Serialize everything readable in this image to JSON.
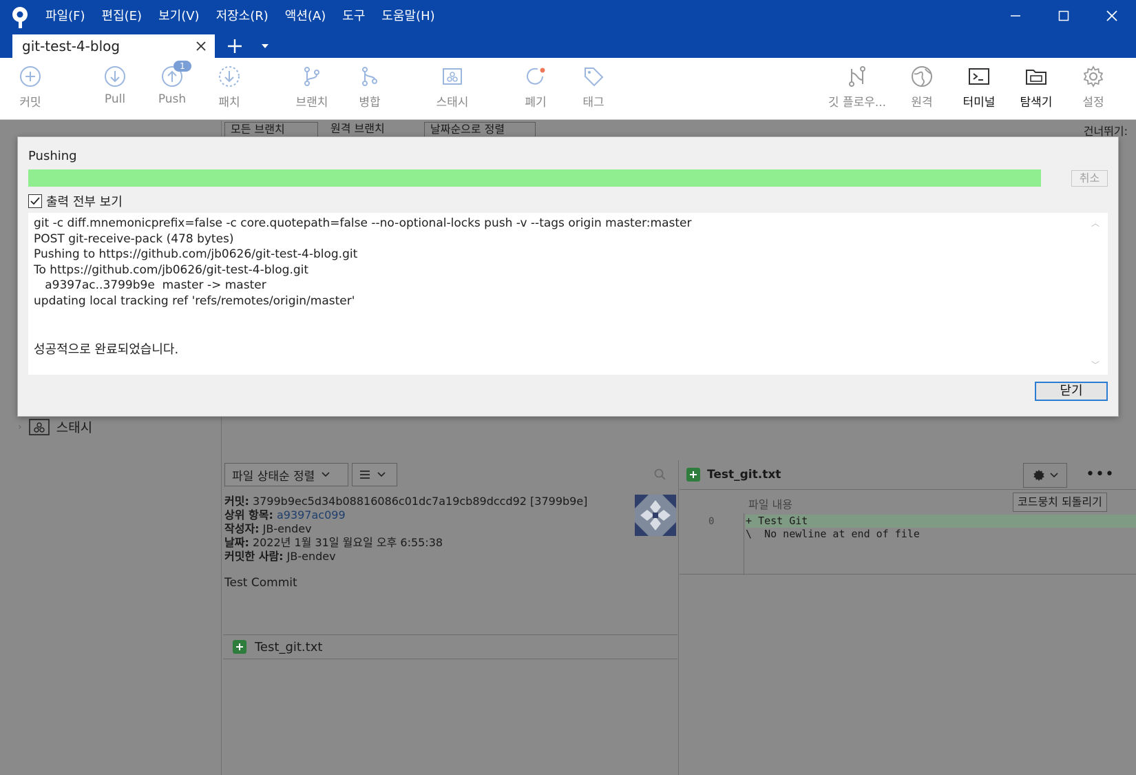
{
  "menu": [
    "파일(F)",
    "편집(E)",
    "보기(V)",
    "저장소(R)",
    "액션(A)",
    "도구",
    "도움말(H)"
  ],
  "tab": {
    "title": "git-test-4-blog"
  },
  "toolbar": {
    "commit": "커밋",
    "pull": "Pull",
    "push": "Push",
    "push_badge": "1",
    "patch": "패치",
    "branch": "브랜치",
    "merge": "병합",
    "stash": "스태시",
    "discard": "폐기",
    "tag": "태그",
    "gitflow": "깃 플로우...",
    "remote": "원격",
    "terminal": "터미널",
    "explorer": "탐색기",
    "settings": "설정"
  },
  "filter_bar": {
    "branches": "모든 브랜치",
    "remote_branches": "원격 브랜치",
    "sort": "날짜순으로 정렬",
    "skip": "건너뛰기:"
  },
  "sidebar": {
    "stash_label": "스태시"
  },
  "files_panel": {
    "sort_label": "파일 상태순 정렬",
    "file_name": "Test_git.txt"
  },
  "commit_details": {
    "commit_label": "커밋:",
    "commit_value": "3799b9ec5d34b08816086c01dc7a19cb89dccd92 [3799b9e]",
    "parent_label": "상위 항목:",
    "parent_value": "a9397ac099",
    "author_label": "작성자:",
    "author_value": "JB-endev",
    "date_label": "날짜:",
    "date_value": "2022년 1월 31일 월요일 오후 6:55:38",
    "committer_label": "커밋한 사람:",
    "committer_value": "JB-endev",
    "message": "Test Commit"
  },
  "diff": {
    "file_name": "Test_git.txt",
    "content_title": "파일 내용",
    "revert_label": "코드뭉치 되돌리기",
    "line_number": "0",
    "line1": "+ Test Git",
    "line2": "\\  No newline at end of file",
    "more": "•••"
  },
  "dialog": {
    "title": "Pushing",
    "progress": 1.0,
    "cancel_label": "취소",
    "show_output_label": "출력 전부 보기",
    "show_output_checked": true,
    "output_lines": [
      "git -c diff.mnemonicprefix=false -c core.quotepath=false --no-optional-locks push -v --tags origin master:master",
      "POST git-receive-pack (478 bytes)",
      "Pushing to https://github.com/jb0626/git-test-4-blog.git",
      "To https://github.com/jb0626/git-test-4-blog.git",
      "   a9397ac..3799b9e  master -> master",
      "updating local tracking ref 'refs/remotes/origin/master'"
    ],
    "success_message": "성공적으로 완료되었습니다.",
    "close_label": "닫기"
  },
  "colors": {
    "titlebar": "#0a47a9",
    "progress": "#90ee90",
    "close_border": "#2b7cd3"
  }
}
